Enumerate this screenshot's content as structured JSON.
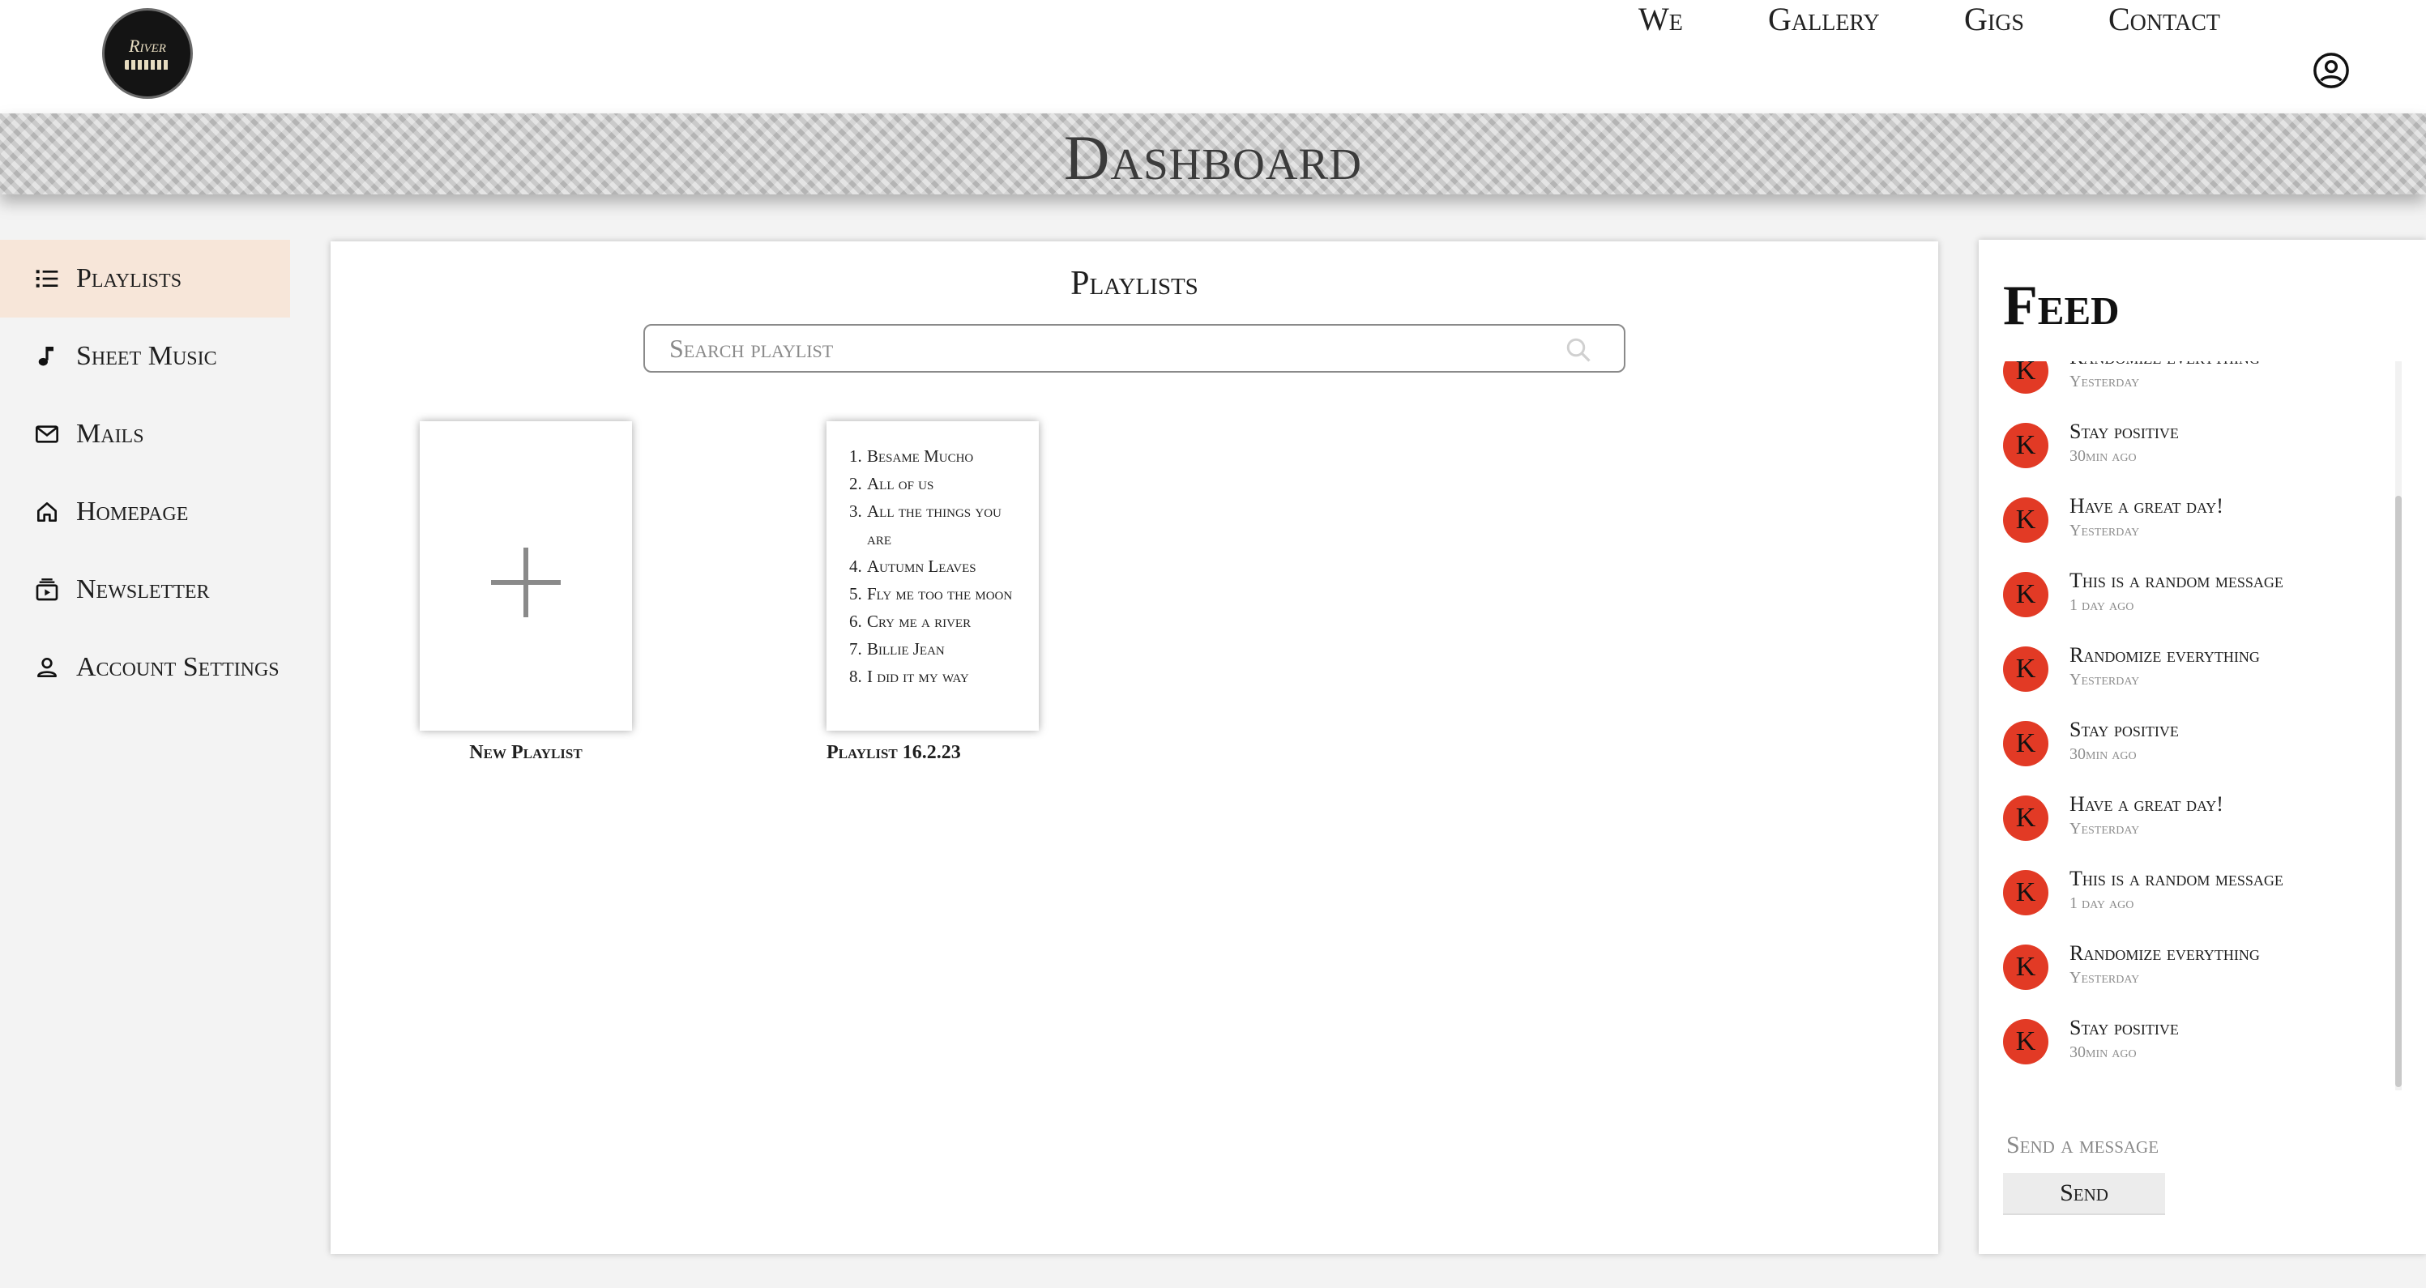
{
  "header": {
    "logo_text": "River",
    "nav": [
      {
        "label": "We"
      },
      {
        "label": "Gallery"
      },
      {
        "label": "Gigs"
      },
      {
        "label": "Contact"
      }
    ]
  },
  "banner": {
    "title": "Dashboard"
  },
  "sidebar": {
    "items": [
      {
        "label": "Playlists",
        "icon": "list-icon",
        "active": true
      },
      {
        "label": "Sheet Music",
        "icon": "music-note-icon"
      },
      {
        "label": "Mails",
        "icon": "mail-icon"
      },
      {
        "label": "Homepage",
        "icon": "home-icon"
      },
      {
        "label": "Newsletter",
        "icon": "newsletter-icon"
      },
      {
        "label": "Account Settings",
        "icon": "person-icon"
      }
    ]
  },
  "main": {
    "title": "Playlists",
    "search": {
      "placeholder": "Search playlist",
      "value": ""
    },
    "new_card": {
      "caption": "New Playlist"
    },
    "playlist_card": {
      "caption": "Playlist 16.2.23",
      "songs": [
        {
          "num": "1.",
          "title": "Besame Mucho"
        },
        {
          "num": "2.",
          "title": "All of us"
        },
        {
          "num": "3.",
          "title": "All the things you are"
        },
        {
          "num": "4.",
          "title": "Autumn Leaves"
        },
        {
          "num": "5.",
          "title": "Fly me too the moon"
        },
        {
          "num": "6.",
          "title": "Cry me a river"
        },
        {
          "num": "7.",
          "title": "Billie Jean"
        },
        {
          "num": "8.",
          "title": "I did it my way"
        }
      ]
    }
  },
  "feed": {
    "title": "Feed",
    "items": [
      {
        "initial": "K",
        "message": "Randomize everything",
        "time": "Yesterday"
      },
      {
        "initial": "K",
        "message": "Stay positive",
        "time": "30min ago"
      },
      {
        "initial": "K",
        "message": "Have a great day!",
        "time": "Yesterday"
      },
      {
        "initial": "K",
        "message": "This is a random message",
        "time": "1 day ago"
      },
      {
        "initial": "K",
        "message": "Randomize everything",
        "time": "Yesterday"
      },
      {
        "initial": "K",
        "message": "Stay positive",
        "time": "30min ago"
      },
      {
        "initial": "K",
        "message": "Have a great day!",
        "time": "Yesterday"
      },
      {
        "initial": "K",
        "message": "This is a random message",
        "time": "1 day ago"
      },
      {
        "initial": "K",
        "message": "Randomize everything",
        "time": "Yesterday"
      },
      {
        "initial": "K",
        "message": "Stay positive",
        "time": "30min ago"
      }
    ],
    "input_placeholder": "Send a message",
    "send_label": "Send",
    "avatar_color": "#e23a25"
  }
}
